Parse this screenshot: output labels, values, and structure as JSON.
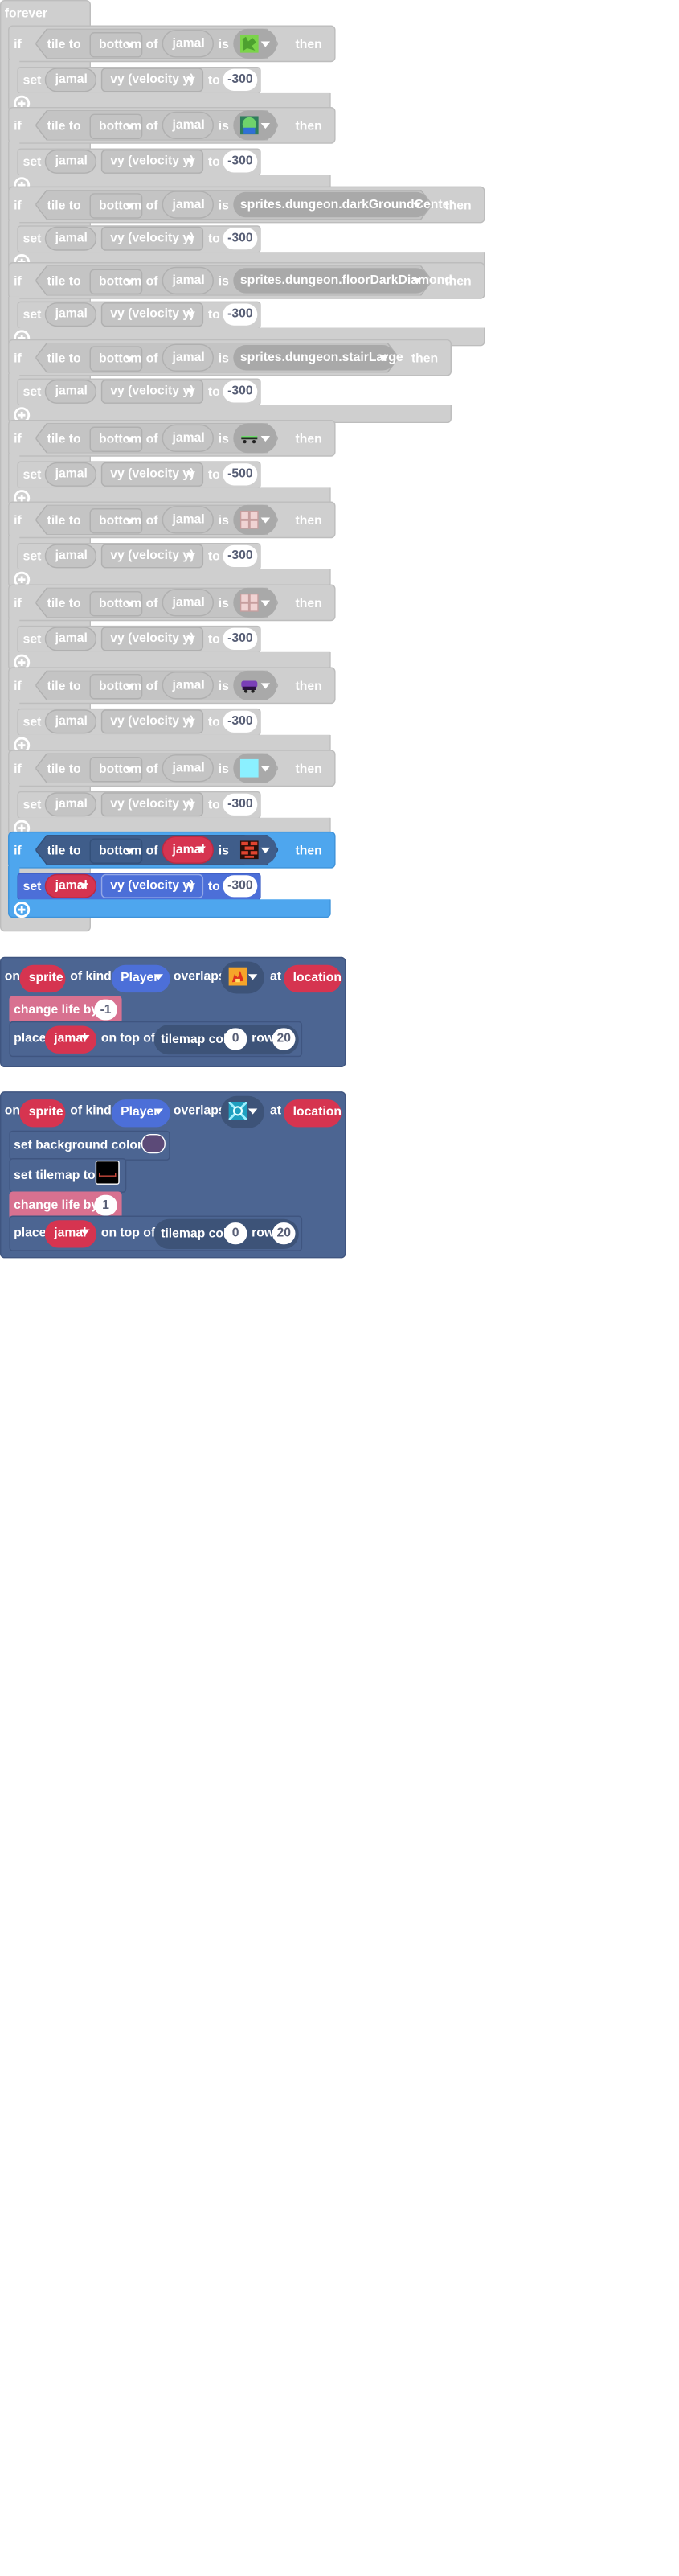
{
  "forever_block": {
    "label": "forever"
  },
  "if_block": {
    "if_label": "if",
    "then_label": "then",
    "tile_to_label": "tile to",
    "of_label": "of",
    "is_label": "is",
    "set_label": "set",
    "to_label": "to"
  },
  "if_rows": [
    {
      "side": "bottom",
      "sprite": "jamal",
      "tile_name": "",
      "tile_icon": "green-grass-tile-icon",
      "property": "vy (velocity y)",
      "value": "-300",
      "active": false
    },
    {
      "side": "bottom",
      "sprite": "jamal",
      "tile_name": "",
      "tile_icon": "green-bush-tile-icon",
      "property": "vy (velocity y)",
      "value": "-300",
      "active": false
    },
    {
      "side": "bottom",
      "sprite": "jamal",
      "tile_name": "sprites.dungeon.darkGroundCenter",
      "tile_icon": "",
      "property": "vy (velocity y)",
      "value": "-300",
      "active": false
    },
    {
      "side": "bottom",
      "sprite": "jamal",
      "tile_name": "sprites.dungeon.floorDarkDiamond",
      "tile_icon": "",
      "property": "vy (velocity y)",
      "value": "-300",
      "active": false
    },
    {
      "side": "bottom",
      "sprite": "jamal",
      "tile_name": "sprites.dungeon.stairLarge",
      "tile_icon": "",
      "property": "vy (velocity y)",
      "value": "-300",
      "active": false
    },
    {
      "side": "bottom",
      "sprite": "jamal",
      "tile_name": "",
      "tile_icon": "skateboard-tile-icon",
      "property": "vy (velocity y)",
      "value": "-500",
      "active": false
    },
    {
      "side": "bottom",
      "sprite": "jamal",
      "tile_name": "",
      "tile_icon": "pink-brick-tile-icon",
      "property": "vy (velocity y)",
      "value": "-300",
      "active": false
    },
    {
      "side": "bottom",
      "sprite": "jamal",
      "tile_name": "",
      "tile_icon": "pink-brick-tile-icon",
      "property": "vy (velocity y)",
      "value": "-300",
      "active": false
    },
    {
      "side": "bottom",
      "sprite": "jamal",
      "tile_name": "",
      "tile_icon": "purple-cart-tile-icon",
      "property": "vy (velocity y)",
      "value": "-300",
      "active": false
    },
    {
      "side": "bottom",
      "sprite": "jamal",
      "tile_name": "",
      "tile_icon": "light-cyan-tile-icon",
      "property": "vy (velocity y)",
      "value": "-300",
      "active": false
    },
    {
      "side": "bottom",
      "sprite": "jamal",
      "tile_name": "",
      "tile_icon": "red-brick-tile-icon",
      "property": "vy (velocity y)",
      "value": "-300",
      "active": true
    }
  ],
  "overlap_event_1": {
    "on_label": "on",
    "sprite_var": "sprite",
    "of_kind_label": "of kind",
    "kind": "Player",
    "overlaps_label": "overlaps",
    "tile_icon": "fire-tile-icon",
    "at_label": "at",
    "location_var": "location",
    "change_life_label": "change life by",
    "change_life_value": "-1",
    "place_label": "place",
    "place_sprite": "jamal",
    "on_top_of_label": "on top of",
    "tilemap_col_label": "tilemap col",
    "col_value": "0",
    "row_label": "row",
    "row_value": "20"
  },
  "overlap_event_2": {
    "on_label": "on",
    "sprite_var": "sprite",
    "of_kind_label": "of kind",
    "kind": "Player",
    "overlaps_label": "overlaps",
    "tile_icon": "cyan-portal-tile-icon",
    "at_label": "at",
    "location_var": "location",
    "set_bg_label": "set background color to",
    "bg_color": "#5c4a78",
    "set_tilemap_label": "set tilemap to",
    "change_life_label": "change life by",
    "change_life_value": "1",
    "place_label": "place",
    "place_sprite": "jamal",
    "on_top_of_label": "on top of",
    "tilemap_col_label": "tilemap col",
    "col_value": "0",
    "row_label": "row",
    "row_value": "20"
  },
  "colors": {
    "disabled_block": "#cfcfcf",
    "active_if": "#4ea6ee",
    "active_set": "#4c6fd8",
    "event_block": "#4c6592",
    "sprite_var": "#d63450",
    "life_block": "#d87190",
    "kind_pill": "#4c6fd8"
  }
}
